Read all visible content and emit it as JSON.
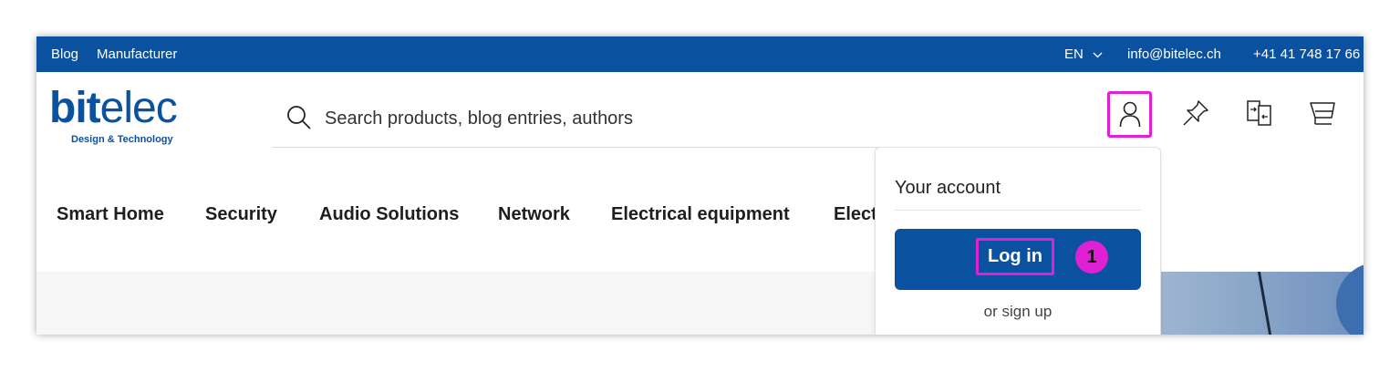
{
  "topbar": {
    "links": [
      "Blog",
      "Manufacturer"
    ],
    "language": "EN",
    "email": "info@bitelec.ch",
    "phone": "+41 41 748 17 66",
    "bg_color": "#0a51a0"
  },
  "logo": {
    "bit": "bit",
    "elec": "elec",
    "tagline": "Design & Technology"
  },
  "search": {
    "placeholder": "Search products, blog entries, authors",
    "icon": "search-icon"
  },
  "header_icons": [
    "user-icon",
    "pin-icon",
    "compare-icon",
    "cart-icon"
  ],
  "nav": {
    "items": [
      "Smart Home",
      "Security",
      "Audio Solutions",
      "Network",
      "Electrical equipment",
      "Elect"
    ]
  },
  "account_dropdown": {
    "title": "Your account",
    "login_label": "Log in",
    "signup_label": "or sign up",
    "step_badge": "1"
  },
  "colors": {
    "accent": "#0a51a0",
    "highlight": "#e020d4"
  }
}
